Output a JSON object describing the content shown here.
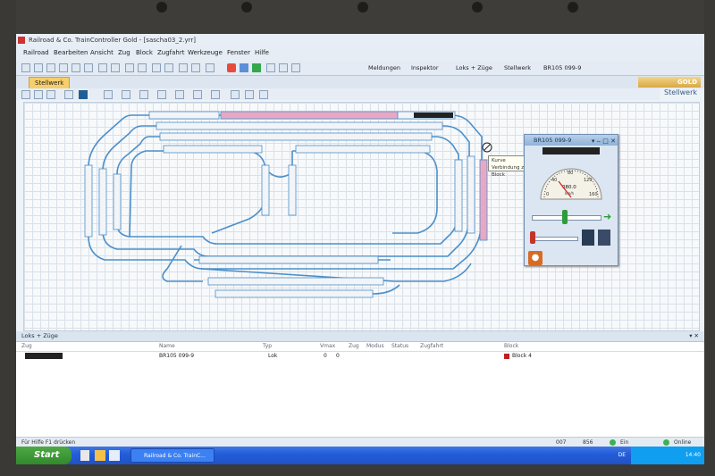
{
  "window": {
    "title": "Railroad & Co. TrainController Gold - [sascha03_2.yrr]"
  },
  "menu": [
    "Railroad",
    "Bearbeiten",
    "Ansicht",
    "Zug",
    "Block",
    "Zugfahrt",
    "Werkzeuge",
    "Fenster",
    "Hilfe"
  ],
  "toolbar_right_tabs": [
    "Meldungen",
    "Inspektor",
    "Loks + Züge",
    "Stellwerk",
    "BR105 099-9"
  ],
  "doc_tab": {
    "label": "Stellwerk"
  },
  "brand": {
    "gold": "GOLD",
    "panel_title": "Stellwerk"
  },
  "loco_window": {
    "title": "BR105 099-9",
    "speed_readout": "080.0",
    "unit": "km/h",
    "scale_marks": [
      "0",
      "40",
      "80",
      "120",
      "160"
    ]
  },
  "tooltip": {
    "line1": "Kurve",
    "line2": "Verbindung zum Block"
  },
  "loco_panel": {
    "title": "Loks + Züge",
    "columns": [
      "Zug",
      "Name",
      "Typ",
      "Vmax",
      "Zug",
      "Modus",
      "Status",
      "Zugfahrt",
      "Block"
    ],
    "rows": [
      {
        "name": "BR105 099-9",
        "typ": "Lok",
        "v1": "0",
        "v2": "0",
        "block": "Block 4"
      }
    ]
  },
  "statusbar": {
    "help": "Für Hilfe F1 drücken",
    "num1": "007",
    "num2": "856",
    "ein": "Ein",
    "online": "Online"
  },
  "taskbar": {
    "start": "Start",
    "task": "Railroad & Co. TrainC...",
    "lang": "DE",
    "clock": "14:40"
  },
  "colors": {
    "track": "#4b8fc9",
    "occupied": "#e8a8c4",
    "accent": "#f6ce6a"
  }
}
